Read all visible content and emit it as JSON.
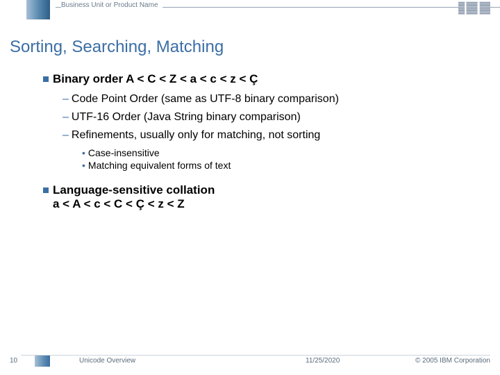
{
  "header": {
    "business_unit": "Business Unit or Product Name"
  },
  "slide": {
    "title": "Sorting, Searching, Matching",
    "bullet1": "Binary order  A < C < Z < a < c < z < Ç",
    "sub1a": "Code Point Order (same as UTF-8 binary comparison)",
    "sub1b": "UTF-16 Order (Java String binary comparison)",
    "sub1c": "Refinements, usually only for matching, not sorting",
    "sub1c_i": "Case-insensitive",
    "sub1c_ii": "Matching equivalent forms of text",
    "bullet2_line1": "Language-sensitive collation",
    "bullet2_line2": "a < A < c < C < Ç < z < Z"
  },
  "footer": {
    "page": "10",
    "doc_title": "Unicode Overview",
    "date": "11/25/2020",
    "copyright": "© 2005 IBM Corporation"
  }
}
